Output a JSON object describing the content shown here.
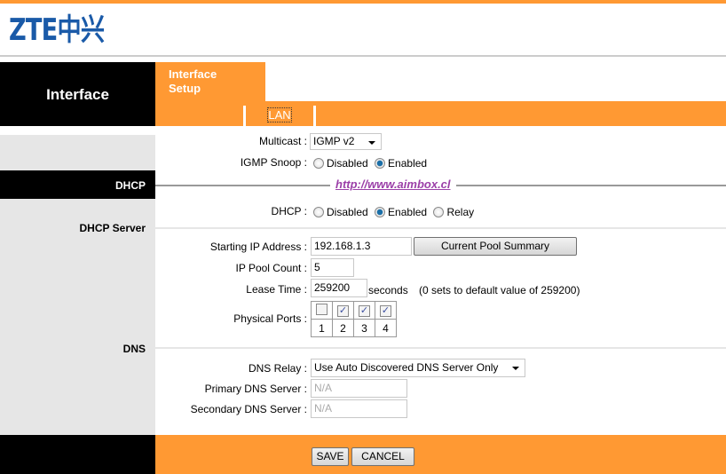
{
  "logo": {
    "text": "ZTE中兴"
  },
  "header": {
    "section": "Interface",
    "tab": "Interface Setup",
    "subtab": "LAN"
  },
  "watermark": "http://www.aimbox.cl",
  "sections": {
    "dhcp": "DHCP",
    "dhcp_server": "DHCP Server",
    "dns": "DNS"
  },
  "multicast": {
    "label": "Multicast :",
    "value": "IGMP v2"
  },
  "igmp_snoop": {
    "label": "IGMP Snoop :",
    "options": [
      "Disabled",
      "Enabled"
    ],
    "selected": "Enabled"
  },
  "dhcp": {
    "label": "DHCP :",
    "options": [
      "Disabled",
      "Enabled",
      "Relay"
    ],
    "selected": "Enabled"
  },
  "starting_ip": {
    "label": "Starting IP Address :",
    "value": "192.168.1.3",
    "button": "Current Pool Summary"
  },
  "pool_count": {
    "label": "IP Pool Count :",
    "value": "5"
  },
  "lease": {
    "label": "Lease Time :",
    "value": "259200",
    "unit": "seconds",
    "note": "(0 sets to default value of 259200)"
  },
  "ports": {
    "label": "Physical Ports :",
    "items": [
      {
        "n": "1",
        "checked": false
      },
      {
        "n": "2",
        "checked": true
      },
      {
        "n": "3",
        "checked": true
      },
      {
        "n": "4",
        "checked": true
      }
    ]
  },
  "dns_relay": {
    "label": "DNS Relay :",
    "value": "Use Auto Discovered DNS Server Only"
  },
  "primary_dns": {
    "label": "Primary DNS Server :",
    "placeholder": "N/A"
  },
  "secondary_dns": {
    "label": "Secondary DNS Server :",
    "placeholder": "N/A"
  },
  "footer": {
    "save": "SAVE",
    "cancel": "CANCEL"
  },
  "colors": {
    "orange": "#ff9933",
    "black": "#000000",
    "gray": "#e6e6e6",
    "watermark": "#9b3fa8",
    "logo_blue": "#1a5aa8"
  }
}
